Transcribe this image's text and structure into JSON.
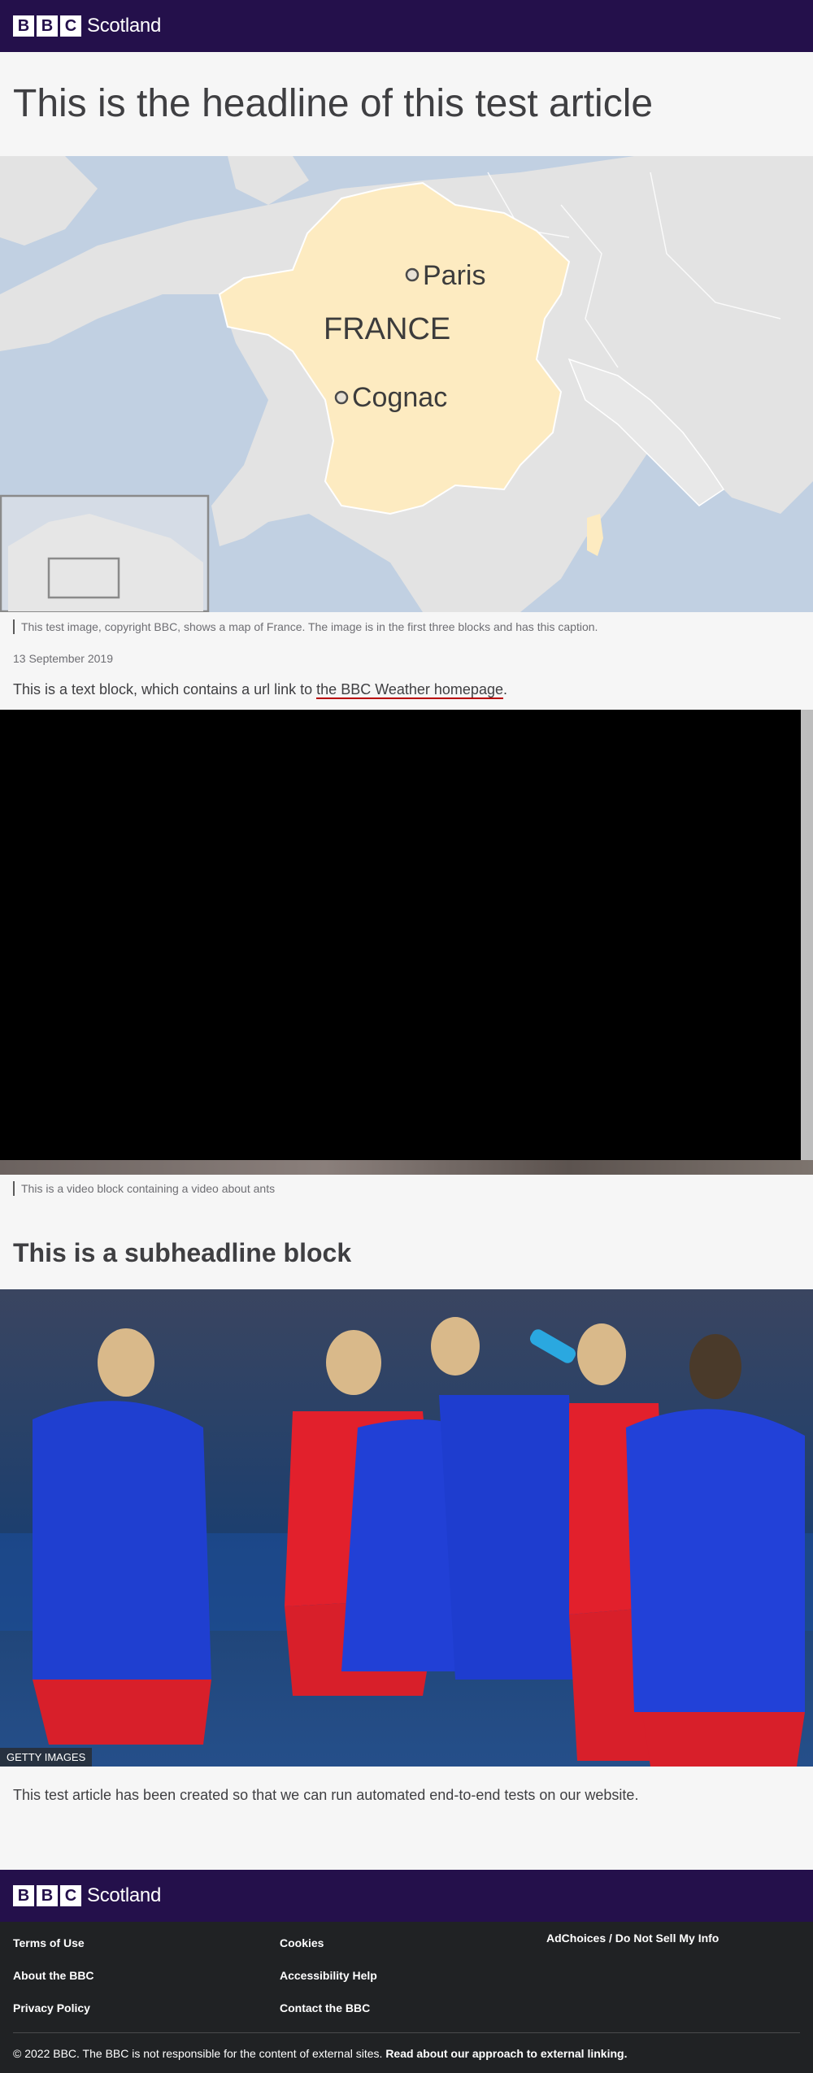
{
  "header": {
    "brand_blocks": [
      "B",
      "B",
      "C"
    ],
    "brand_name": "Scotland"
  },
  "article": {
    "headline": "This is the headline of this test article",
    "map": {
      "labels": {
        "country": "FRANCE",
        "city1": "Paris",
        "city2": "Cognac"
      },
      "caption": "This test image, copyright BBC, shows a map of France. The image is in the first three blocks and has this caption."
    },
    "date": "13 September 2019",
    "text_block": {
      "before": "This is a text block, which contains a url link to ",
      "link": "the BBC Weather homepage",
      "after": "."
    },
    "video_caption": "This is a video block containing a video about ants",
    "subheadline": "This is a subheadline block",
    "photo_credit": "GETTY IMAGES",
    "closing_paragraph": "This test article has been created so that we can run automated end-to-end tests on our website."
  },
  "footer": {
    "brand_blocks": [
      "B",
      "B",
      "C"
    ],
    "brand_name": "Scotland",
    "links": {
      "terms": "Terms of Use",
      "about": "About the BBC",
      "privacy": "Privacy Policy",
      "cookies": "Cookies",
      "accessibility": "Accessibility Help",
      "contact": "Contact the BBC",
      "adchoices": "AdChoices / Do Not Sell My Info"
    },
    "copyright": "© 2022 BBC. The BBC is not responsible for the content of external sites.",
    "external_link": "Read about our approach to external linking."
  },
  "colors": {
    "brand": "#24104b",
    "link_underline": "#b80000",
    "footer_bg": "#202224"
  }
}
